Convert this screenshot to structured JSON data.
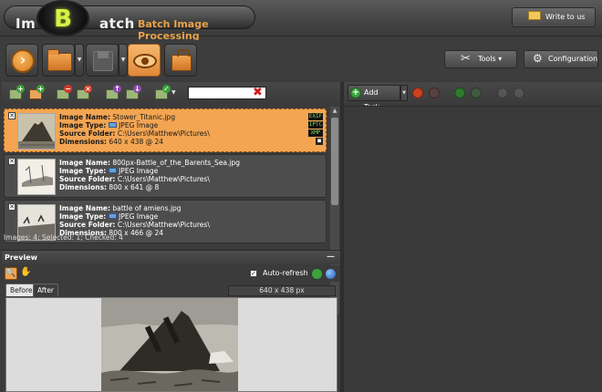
{
  "app": {
    "logo_left": "Im",
    "logo_b": "B",
    "logo_right": "atch",
    "tagline": "Batch Image Processing",
    "write_to_us": "Write to us"
  },
  "toolbar": {
    "tools_label": "Tools",
    "config_label": "Configuration"
  },
  "image_list": {
    "items": [
      {
        "checked_mark": "✕",
        "name_label": "Image Name:",
        "name": "Stower_Titanic.jpg",
        "type_label": "Image Type:",
        "type": "JPEG Image",
        "folder_label": "Source Folder:",
        "folder": "C:\\Users\\Matthew\\Pictures\\",
        "dims_label": "Dimensions:",
        "dims": "640 x 438 @ 24",
        "tags": [
          "EXIF",
          "IPTC",
          "XMP",
          "■"
        ]
      },
      {
        "checked_mark": "✕",
        "name_label": "Image Name:",
        "name": "800px-Battle_of_the_Barents_Sea.jpg",
        "type_label": "Image Type:",
        "type": "JPEG Image",
        "folder_label": "Source Folder:",
        "folder": "C:\\Users\\Matthew\\Pictures\\",
        "dims_label": "Dimensions:",
        "dims": "800 x 641 @ 8"
      },
      {
        "checked_mark": "✕",
        "name_label": "Image Name:",
        "name": "battle of amiens.jpg",
        "type_label": "Image Type:",
        "type": "JPEG Image",
        "folder_label": "Source Folder:",
        "folder": "C:\\Users\\Matthew\\Pictures\\",
        "dims_label": "Dimensions:",
        "dims": "800 x 466 @ 24"
      }
    ],
    "status": "Images: 4; Selected: 1; Checked: 4"
  },
  "preview": {
    "title": "Preview",
    "auto_refresh": "Auto-refresh",
    "auto_refresh_mark": "✓",
    "tab_before": "Before",
    "tab_after": "After",
    "dimensions": "640 x 438 px"
  },
  "tasks": {
    "add_task": "Add Task..."
  },
  "colors": {
    "accent": "#f3a552",
    "panel": "#3b3b3b",
    "logo_green": "#d8f04a",
    "tagline": "#e8a24a"
  }
}
